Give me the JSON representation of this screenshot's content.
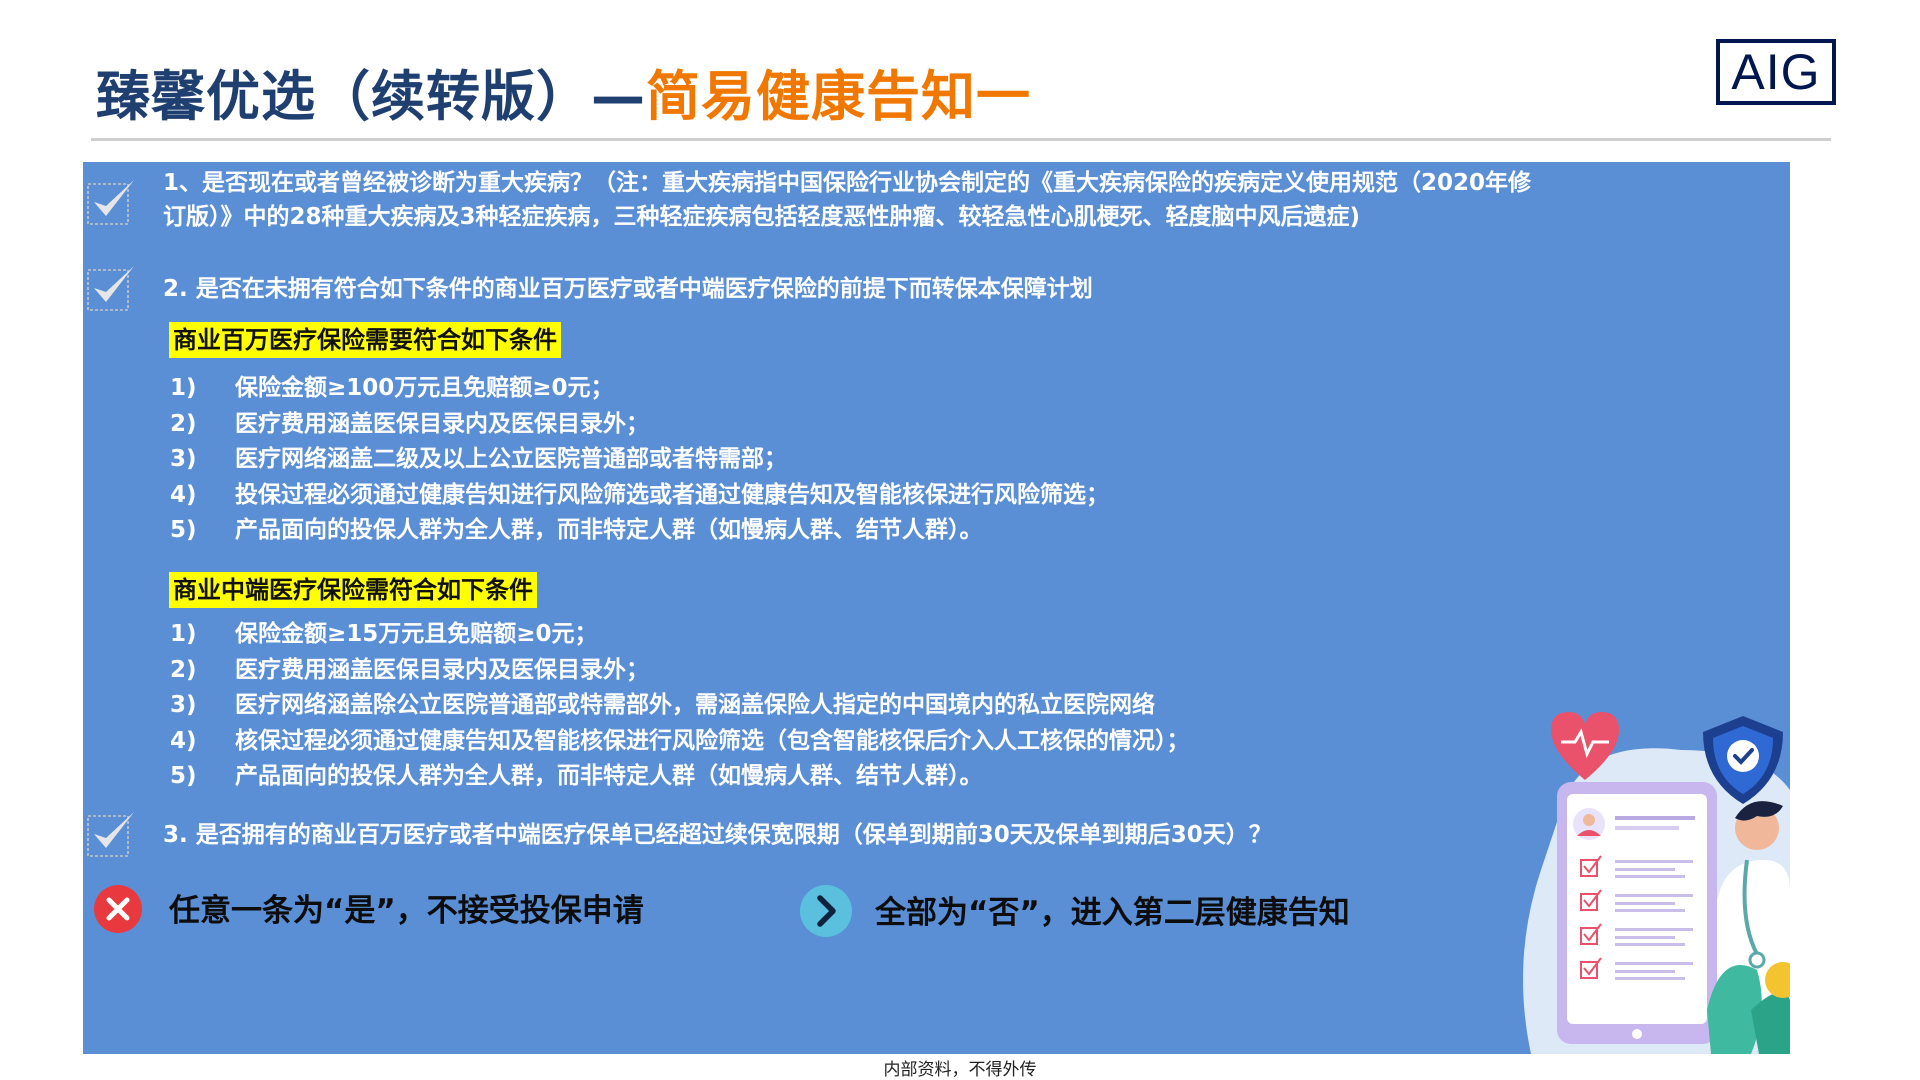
{
  "title": {
    "part1": "臻馨优选（续转版）—",
    "part2": "简易健康告知一"
  },
  "brand": {
    "logo_text": "AIG",
    "color": "#00164e"
  },
  "colors": {
    "panel": "#5a8fd6",
    "accent": "#f07800",
    "title": "#1e3f70",
    "highlight": "#ffff00",
    "reject": "#e8393f",
    "proceed": "#5bc0de"
  },
  "questions": [
    {
      "icon": "checkmark-icon",
      "line1": "1、是否现在或者曾经被诊断为重大疾病？（注：重大疾病指中国保险行业协会制定的《重大疾病保险的疾病定义使用规范（2020年修",
      "line2": "订版）》中的28种重大疾病及3种轻症疾病，三种轻症疾病包括轻度恶性肿瘤、较轻急性心肌梗死、轻度脑中风后遗症)"
    },
    {
      "icon": "checkmark-icon",
      "text": "2. 是否在未拥有符合如下条件的商业百万医疗或者中端医疗保险的前提下而转保本保障计划"
    },
    {
      "icon": "checkmark-icon",
      "text": "3. 是否拥有的商业百万医疗或者中端医疗保单已经超过续保宽限期（保单到期前30天及保单到期后30天）？"
    }
  ],
  "million_plan": {
    "heading": "商业百万医疗保险需要符合如下条件",
    "items": [
      {
        "num": "1)",
        "text": "保险金额≥100万元且免赔额≥0元；"
      },
      {
        "num": "2)",
        "text": "医疗费用涵盖医保目录内及医保目录外；"
      },
      {
        "num": "3)",
        "text": "医疗网络涵盖二级及以上公立医院普通部或者特需部；"
      },
      {
        "num": "4)",
        "text": "投保过程必须通过健康告知进行风险筛选或者通过健康告知及智能核保进行风险筛选；"
      },
      {
        "num": "5)",
        "text": "产品面向的投保人群为全人群，而非特定人群（如慢病人群、结节人群）。"
      }
    ]
  },
  "mid_plan": {
    "heading": "商业中端医疗保险需符合如下条件",
    "items": [
      {
        "num": "1)",
        "text": "保险金额≥15万元且免赔额≥0元；"
      },
      {
        "num": "2)",
        "text": "医疗费用涵盖医保目录内及医保目录外；"
      },
      {
        "num": "3)",
        "text": "医疗网络涵盖除公立医院普通部或特需部外，需涵盖保险人指定的中国境内的私立医院网络"
      },
      {
        "num": "4)",
        "text": "核保过程必须通过健康告知及智能核保进行风险筛选（包含智能核保后介入人工核保的情况）；"
      },
      {
        "num": "5)",
        "text": "产品面向的投保人群为全人群，而非特定人群（如慢病人群、结节人群）。"
      }
    ]
  },
  "results": {
    "reject": {
      "icon": "close-circle-icon",
      "text": "任意一条为“是”，不接受投保申请"
    },
    "proceed": {
      "icon": "chevron-right-circle-icon",
      "text": "全部为“否”，进入第二层健康告知"
    }
  },
  "illustration": {
    "icon": "health-checklist-illustration"
  },
  "footer": {
    "text": "内部资料，不得外传"
  }
}
